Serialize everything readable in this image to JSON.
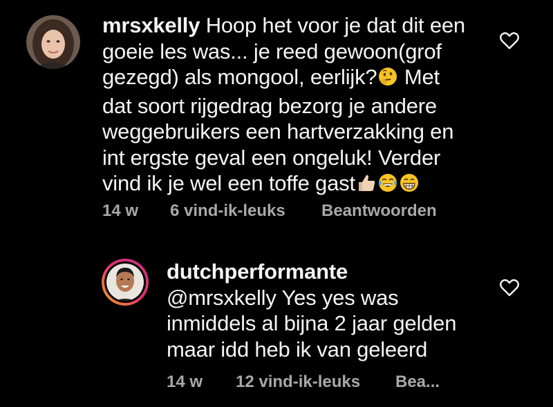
{
  "comments": [
    {
      "username": "mrsxkelly",
      "text_lines": [
        "Hoop het voor je dat dit een",
        "goeie les was... je reed gewoon(grof",
        "gezegd) als mongool, eerlijk?",
        "dat soort rijgedrag bezorg je andere",
        "weggebruikers een hartverzakking en",
        "int ergste geval een ongeluk! Verder",
        "vind ik je wel een toffe gast"
      ],
      "inline_after_line3": "Met",
      "emoji": [
        "thinking-face",
        "thumbs-up",
        "crying-laughing-face",
        "grinning-face"
      ],
      "time": "14 w",
      "likes": "6 vind-ik-leuks",
      "reply": "Beantwoorden",
      "icon": "heart-outline-icon"
    },
    {
      "username": "dutchperformante",
      "text_lines": [
        "@mrsxkelly Yes yes was",
        "inmiddels al bijna 2 jaar gelden",
        "maar idd heb ik van geleerd"
      ],
      "time": "14 w",
      "likes": "12 vind-ik-leuks",
      "reply": "Bea...",
      "icon": "heart-outline-icon",
      "story_ring_colors": [
        "#f9a825",
        "#e1306c",
        "#c13584"
      ]
    }
  ],
  "colors": {
    "background": "#000000",
    "text": "#f5f5f5",
    "meta": "#a8a8a8"
  }
}
